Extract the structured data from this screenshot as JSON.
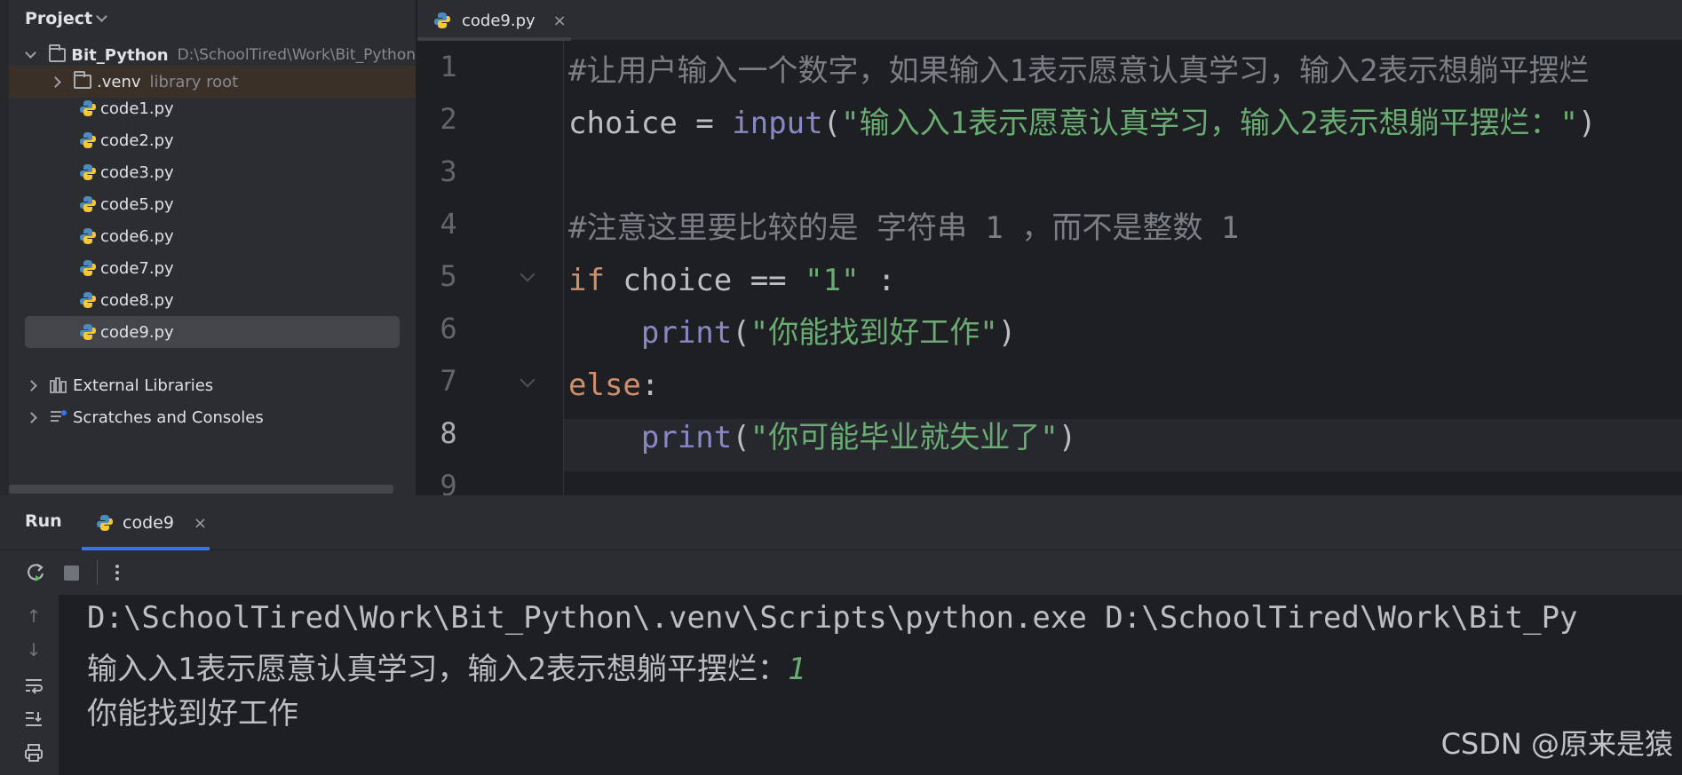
{
  "project_panel": {
    "title": "Project",
    "root": {
      "name": "Bit_Python",
      "path": "D:\\SchoolTired\\Work\\Bit_Python"
    },
    "venv": {
      "name": ".venv",
      "tag": "library root"
    },
    "files": [
      "code1.py",
      "code2.py",
      "code3.py",
      "code5.py",
      "code6.py",
      "code7.py",
      "code8.py",
      "code9.py"
    ],
    "selected_file": "code9.py",
    "external_libraries": "External Libraries",
    "scratches": "Scratches and Consoles"
  },
  "editor": {
    "tab": {
      "label": "code9.py",
      "close": "×"
    },
    "line_numbers": [
      "1",
      "2",
      "3",
      "4",
      "5",
      "6",
      "7",
      "8",
      "9"
    ],
    "current_line": "8",
    "code": {
      "l1_comment": "#让用户输入一个数字，如果输入1表示愿意认真学习，输入2表示想躺平摆烂",
      "l2_var": "choice",
      "l2_op": " = ",
      "l2_fn": "input",
      "l2_open": "(",
      "l2_str": "\"输入入1表示愿意认真学习，输入2表示想躺平摆烂：\"",
      "l2_close": ")",
      "l4_comment": "#注意这里要比较的是 字符串 1 ，而不是整数 1",
      "l5_kw": "if",
      "l5_mid": " choice == ",
      "l5_str": "\"1\"",
      "l5_end": " :",
      "l6_indent": "    ",
      "l6_fn": "print",
      "l6_open": "(",
      "l6_str": "\"你能找到好工作\"",
      "l6_close": ")",
      "l7_kw": "else",
      "l7_end": ":",
      "l8_indent": "    ",
      "l8_fn": "print",
      "l8_open": "(",
      "l8_str": "\"你可能毕业就失业了\"",
      "l8_close": ")"
    }
  },
  "run_panel": {
    "title": "Run",
    "tab": {
      "label": "code9",
      "close": "×"
    },
    "console": {
      "command": "D:\\SchoolTired\\Work\\Bit_Python\\.venv\\Scripts\\python.exe D:\\SchoolTired\\Work\\Bit_Py",
      "prompt": "输入入1表示愿意认真学习，输入2表示想躺平摆烂：",
      "input_echo": "1",
      "output": "你能找到好工作"
    }
  },
  "watermark": "CSDN @原来是猿",
  "colors": {
    "keyword": "#cf8e6d",
    "function": "#8888c6",
    "string": "#6aab73",
    "comment": "#7a7e85",
    "accent": "#3574f0"
  }
}
